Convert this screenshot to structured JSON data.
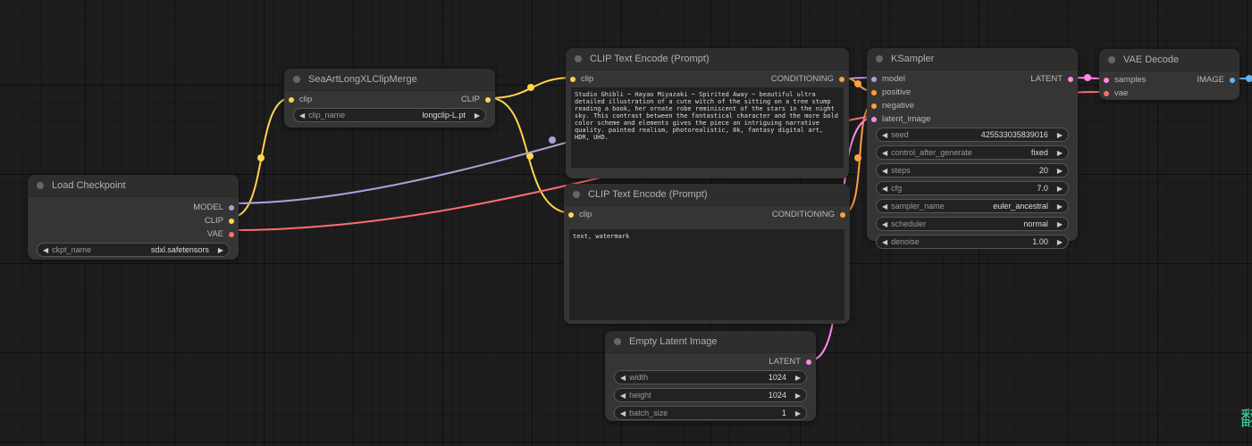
{
  "colors": {
    "model": "#b39ddb",
    "clip": "#ffd54f",
    "vae": "#ff6e6e",
    "conditioning": "#ffa040",
    "latent": "#ff88e8",
    "image": "#64b5f6"
  },
  "nodes": {
    "load_checkpoint": {
      "title": "Load Checkpoint",
      "outputs": [
        "MODEL",
        "CLIP",
        "VAE"
      ],
      "widgets": [
        {
          "label": "ckpt_name",
          "value": "sdxl.safetensors"
        }
      ]
    },
    "clip_merge": {
      "title": "SeaArtLongXLClipMerge",
      "inputs": [
        "clip"
      ],
      "outputs": [
        "CLIP"
      ],
      "widgets": [
        {
          "label": "clip_name",
          "value": "longclip-L.pt"
        }
      ]
    },
    "clip_encode_pos": {
      "title": "CLIP Text Encode (Prompt)",
      "inputs": [
        "clip"
      ],
      "outputs": [
        "CONDITIONING"
      ],
      "text": "Studio Ghibli ~ Hayao Miyazaki ~ Spirited Away ~ beautiful ultra detailed illustration of a cute witch of the sitting on a tree stump reading a book, her ornate robe reminiscent of the stars in the night sky. This contrast between the fantastical character and the more bold color scheme and elements gives the piece an intriguing narrative quality. painted realism, photorealistic, 8k, fantasy digital art, HDR, UHD."
    },
    "clip_encode_neg": {
      "title": "CLIP Text Encode (Prompt)",
      "inputs": [
        "clip"
      ],
      "outputs": [
        "CONDITIONING"
      ],
      "text": "text, watermark"
    },
    "ksampler": {
      "title": "KSampler",
      "inputs": [
        "model",
        "positive",
        "negative",
        "latent_image"
      ],
      "outputs": [
        "LATENT"
      ],
      "widgets": [
        {
          "label": "seed",
          "value": "425533035839016"
        },
        {
          "label": "control_after_generate",
          "value": "fixed"
        },
        {
          "label": "steps",
          "value": "20"
        },
        {
          "label": "cfg",
          "value": "7.0"
        },
        {
          "label": "sampler_name",
          "value": "euler_ancestral"
        },
        {
          "label": "scheduler",
          "value": "normal"
        },
        {
          "label": "denoise",
          "value": "1.00"
        }
      ]
    },
    "vae_decode": {
      "title": "VAE Decode",
      "inputs": [
        "samples",
        "vae"
      ],
      "outputs": [
        "IMAGE"
      ]
    },
    "empty_latent": {
      "title": "Empty Latent Image",
      "outputs": [
        "LATENT"
      ],
      "widgets": [
        {
          "label": "width",
          "value": "1024"
        },
        {
          "label": "height",
          "value": "1024"
        },
        {
          "label": "batch_size",
          "value": "1"
        }
      ]
    }
  },
  "icons": {
    "arrow_left": "◀",
    "arrow_right": "▶"
  },
  "corner_glyph": "翻"
}
